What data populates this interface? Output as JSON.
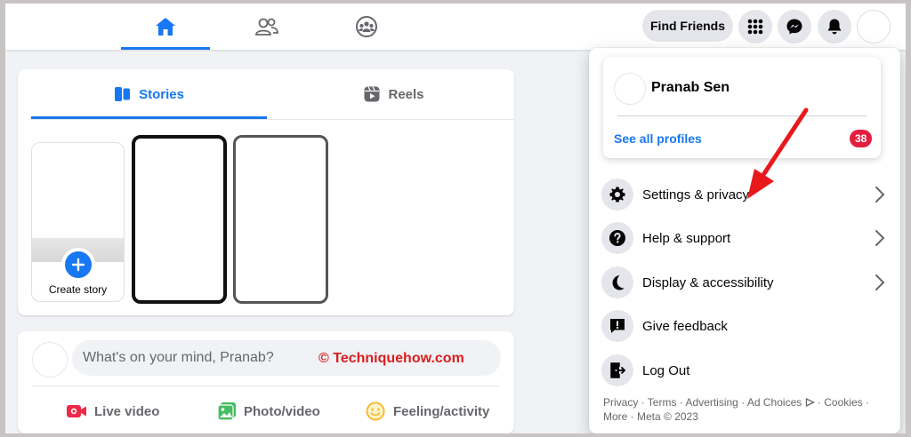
{
  "nav": {
    "tabs": [
      {
        "name": "Home",
        "icon": "home-icon",
        "active": true
      },
      {
        "name": "Friends",
        "icon": "friends-icon",
        "active": false
      },
      {
        "name": "Groups",
        "icon": "groups-icon",
        "active": false
      }
    ],
    "find_friends_label": "Find Friends",
    "accent": "#1877f2"
  },
  "stories": {
    "tabs": [
      {
        "label": "Stories",
        "icon": "stories-icon",
        "active": true
      },
      {
        "label": "Reels",
        "icon": "reels-icon",
        "active": false
      }
    ],
    "create_story_label": "Create story"
  },
  "composer": {
    "placeholder": "What's on your mind, Pranab?",
    "watermark": "© Techniquehow.com",
    "actions": [
      {
        "label": "Live video",
        "icon": "live-video-icon",
        "color": "#f02849"
      },
      {
        "label": "Photo/video",
        "icon": "photo-icon",
        "color": "#45bd62"
      },
      {
        "label": "Feeling/activity",
        "icon": "feeling-icon",
        "color": "#f7b928"
      }
    ]
  },
  "account_menu": {
    "profile": {
      "name": "Pranab Sen",
      "see_all_label": "See all profiles",
      "badge_count": "38"
    },
    "items": [
      {
        "label": "Settings & privacy",
        "icon": "gear-icon",
        "has_chevron": true
      },
      {
        "label": "Help & support",
        "icon": "question-icon",
        "has_chevron": true
      },
      {
        "label": "Display & accessibility",
        "icon": "moon-icon",
        "has_chevron": true
      },
      {
        "label": "Give feedback",
        "icon": "feedback-icon",
        "has_chevron": false
      },
      {
        "label": "Log Out",
        "icon": "logout-icon",
        "has_chevron": false
      }
    ],
    "footer": {
      "privacy": "Privacy",
      "terms": "Terms",
      "advertising": "Advertising",
      "ad_choices": "Ad Choices",
      "cookies": "Cookies",
      "more": "More",
      "meta": "Meta © 2023"
    }
  },
  "annotation": {
    "arrow_color": "#e8191b"
  }
}
